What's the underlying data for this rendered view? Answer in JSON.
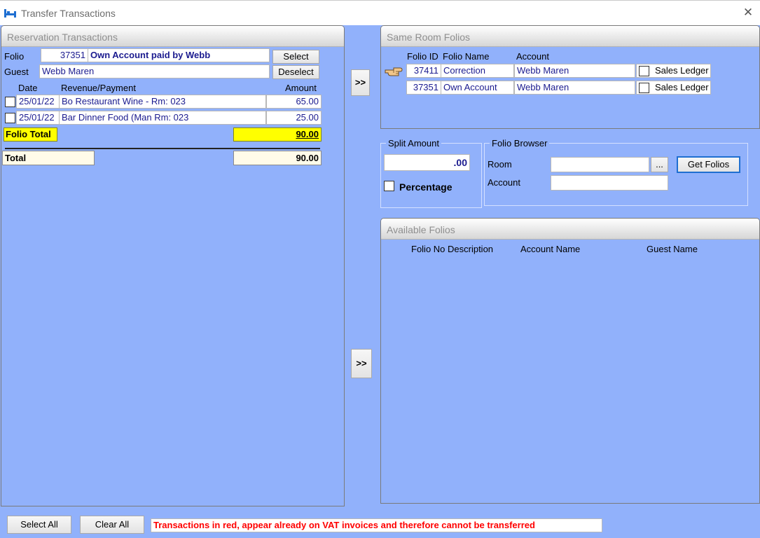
{
  "window": {
    "title": "Transfer Transactions",
    "icon": "bed-icon",
    "close_icon": "close-icon"
  },
  "reservation": {
    "title": "Reservation Transactions",
    "folio_label": "Folio",
    "folio_id": "37351",
    "folio_name": "Own Account paid by Webb",
    "guest_label": "Guest",
    "guest_name": "Webb Maren",
    "select_label": "Select",
    "deselect_label": "Deselect",
    "columns": {
      "date": "Date",
      "revenue": "Revenue/Payment",
      "amount": "Amount"
    },
    "rows": [
      {
        "date": "25/01/22",
        "description": "Bo Restaurant Wine - Rm: 023",
        "amount": "65.00"
      },
      {
        "date": "25/01/22",
        "description": "Bar Dinner Food (Man Rm: 023",
        "amount": "25.00"
      }
    ],
    "folio_total_label": "Folio Total",
    "folio_total_value": "90.00",
    "total_label": "Total",
    "total_value": "90.00"
  },
  "transfer_buttons": {
    "top_label": ">>",
    "bottom_label": ">>"
  },
  "same_room": {
    "title": "Same Room Folios",
    "columns": {
      "folio_id": "Folio ID",
      "folio_name": "Folio Name",
      "account": "Account"
    },
    "pointer_icon": "pointing-hand-icon",
    "rows": [
      {
        "folio_id": "37411",
        "folio_name": "Correction",
        "account": "Webb Maren",
        "ledger": "Sales Ledger"
      },
      {
        "folio_id": "37351",
        "folio_name": "Own Account",
        "account": "Webb Maren",
        "ledger": "Sales Ledger"
      }
    ]
  },
  "split": {
    "label": "Split Amount",
    "value": ".00",
    "percentage_label": "Percentage"
  },
  "browser": {
    "label": "Folio Browser",
    "room_label": "Room",
    "room_value": "",
    "browse_label": "...",
    "account_label": "Account",
    "account_value": "",
    "get_folios_label": "Get Folios"
  },
  "available": {
    "title": "Available Folios",
    "columns": {
      "folio_no": "Folio No",
      "description": "Description",
      "account_name": "Account Name",
      "guest_name": "Guest Name"
    }
  },
  "footer": {
    "select_all_label": "Select All",
    "clear_all_label": "Clear All",
    "notice": "Transactions in red, appear already on VAT invoices and therefore cannot be transferred"
  },
  "colors": {
    "background": "#91b1fb",
    "highlight": "#ffff00",
    "notice_text": "#ff0000",
    "field_text": "#1b1b8f"
  }
}
